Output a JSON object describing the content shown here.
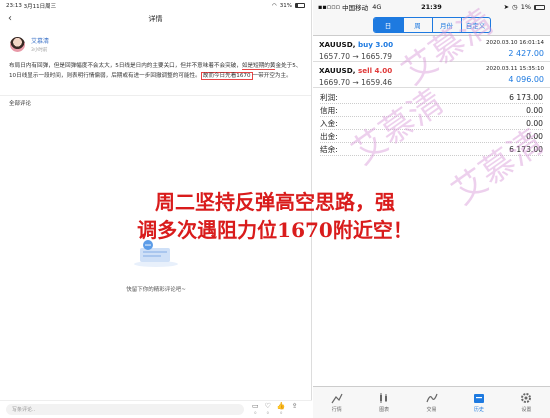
{
  "left": {
    "status": {
      "time": "23:13",
      "date": "3月11日周三",
      "battery": "31%"
    },
    "nav": {
      "title": "详情"
    },
    "author": {
      "name": "艾慕清",
      "time": "3小时前"
    },
    "body": {
      "line1": "布局日内有回弹，但是回弹幅度不会太大，5日线是日内的主要关口，但并不意味着不会突破，",
      "line1b": "如是短期的黄",
      "line2": "金处于5、10日线显示一段时间，则表明行情偏弱，后期或有进一步回撤调整的可能性。",
      "line2b": "故而今日先看1670",
      "line3": "一带开空为主。"
    },
    "section": "全部评论",
    "empty_text": "快留下你的精彩评论吧~",
    "comment": {
      "placeholder": "写条评论..",
      "icons": [
        "0",
        "0",
        "0",
        ""
      ]
    }
  },
  "right": {
    "status": {
      "carrier": "中国移动",
      "network": "4G",
      "time": "21:39",
      "battery": "1%"
    },
    "tabs": [
      "日",
      "周",
      "月份",
      "自定义"
    ],
    "orders": [
      {
        "symbol": "XAUUSD,",
        "side": "buy 3.00",
        "date": "2020.03.10 16:01:14",
        "prices": "1657.70 → 1665.79",
        "pl": "2 427.00"
      },
      {
        "symbol": "XAUUSD,",
        "side": "sell 4.00",
        "date": "2020.03.11 15:35:10",
        "prices": "1669.70 → 1659.46",
        "pl": "4 096.00"
      }
    ],
    "summary": [
      {
        "label": "利润:",
        "value": "6 173.00"
      },
      {
        "label": "信用:",
        "value": "0.00"
      },
      {
        "label": "入金:",
        "value": "0.00"
      },
      {
        "label": "出金:",
        "value": "0.00"
      },
      {
        "label": "结余:",
        "value": "6 173.00"
      }
    ],
    "tabbar": [
      "行情",
      "图表",
      "交易",
      "历史",
      "设置"
    ]
  },
  "overlay": {
    "line1": "周二坚持反弹高空思路，强",
    "line2": "调多次遇阻力位1670附近空！"
  },
  "watermark": "艾慕清",
  "colors": {
    "accent": "#1e7ae0",
    "sell": "#e03a3a",
    "overlay": "#d91c1c"
  }
}
